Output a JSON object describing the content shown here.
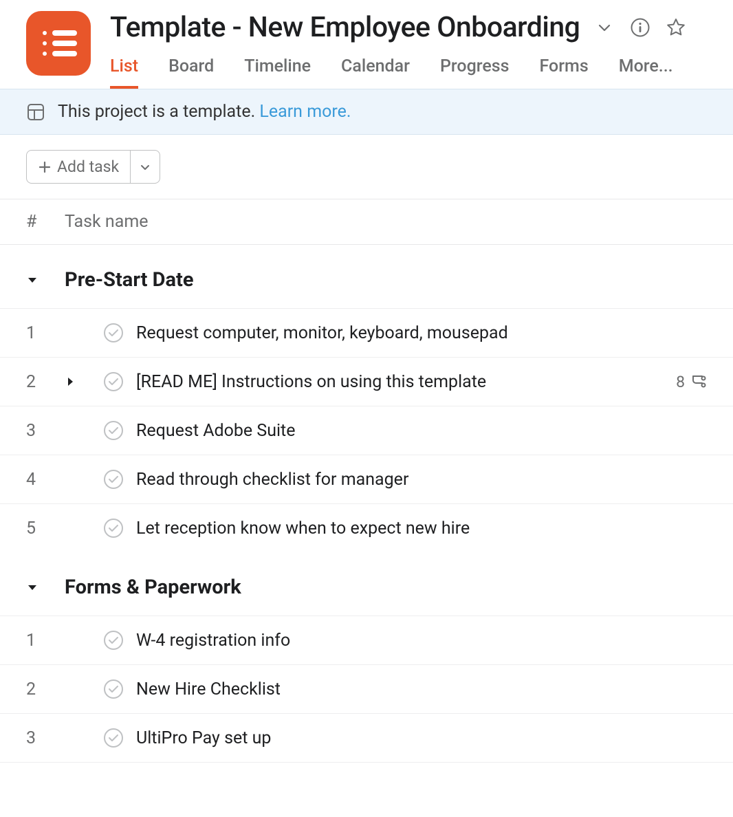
{
  "project": {
    "title": "Template - New Employee Onboarding"
  },
  "tabs": [
    {
      "label": "List",
      "active": true
    },
    {
      "label": "Board",
      "active": false
    },
    {
      "label": "Timeline",
      "active": false
    },
    {
      "label": "Calendar",
      "active": false
    },
    {
      "label": "Progress",
      "active": false
    },
    {
      "label": "Forms",
      "active": false
    },
    {
      "label": "More...",
      "active": false
    }
  ],
  "banner": {
    "text": "This project is a template.",
    "link": "Learn more."
  },
  "toolbar": {
    "add_task_label": "Add task"
  },
  "columns": {
    "num": "#",
    "name": "Task name"
  },
  "sections": [
    {
      "title": "Pre-Start Date",
      "tasks": [
        {
          "num": "1",
          "name": "Request computer, monitor, keyboard, mousepad",
          "expandable": false
        },
        {
          "num": "2",
          "name": "[READ ME] Instructions on using this template",
          "expandable": true,
          "subtask_count": "8"
        },
        {
          "num": "3",
          "name": "Request Adobe Suite",
          "expandable": false
        },
        {
          "num": "4",
          "name": "Read through checklist for manager",
          "expandable": false
        },
        {
          "num": "5",
          "name": "Let reception know when to expect new hire",
          "expandable": false
        }
      ]
    },
    {
      "title": "Forms & Paperwork",
      "tasks": [
        {
          "num": "1",
          "name": " W-4 registration info",
          "expandable": false
        },
        {
          "num": "2",
          "name": "New Hire Checklist",
          "expandable": false
        },
        {
          "num": "3",
          "name": "UltiPro Pay set up",
          "expandable": false
        }
      ]
    }
  ]
}
